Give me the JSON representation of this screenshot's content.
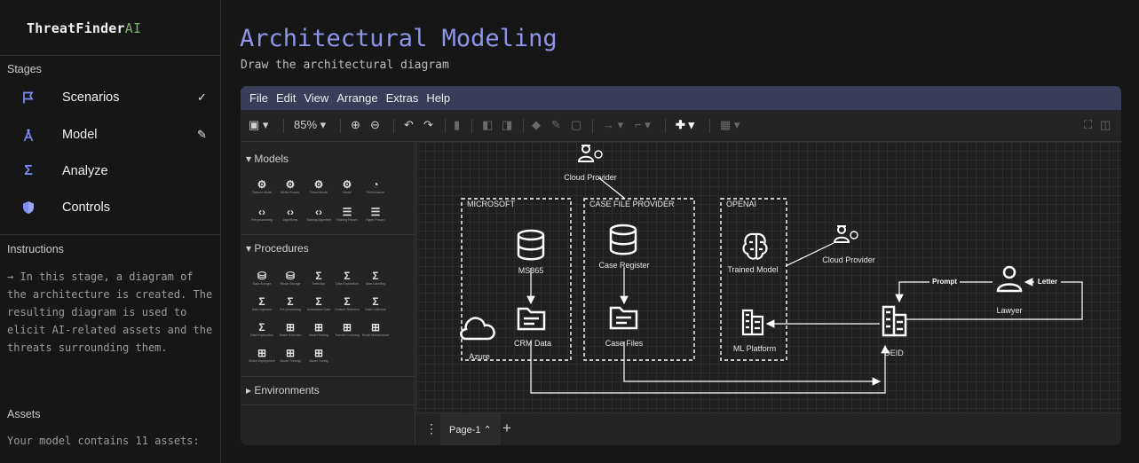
{
  "app": {
    "brand_name": "ThreatFinder",
    "brand_suffix": "AI"
  },
  "sidebar": {
    "stages_label": "Stages",
    "stages": [
      {
        "label": "Scenarios",
        "icon": "flag-icon",
        "status": "✓"
      },
      {
        "label": "Model",
        "icon": "compass-icon",
        "status": "✎"
      },
      {
        "label": "Analyze",
        "icon": "sigma-icon",
        "status": ""
      },
      {
        "label": "Controls",
        "icon": "shield-icon",
        "status": ""
      }
    ],
    "instructions_label": "Instructions",
    "instructions_text": "→ In this stage, a diagram of the architecture is created. The resulting diagram is used to elicit AI-related assets and the threats surrounding them.",
    "assets_label": "Assets",
    "assets_text": "Your model contains 11 assets:"
  },
  "main": {
    "title": "Architectural Modeling",
    "subtitle": "Draw the architectural diagram"
  },
  "editor": {
    "menu": [
      "File",
      "Edit",
      "View",
      "Arrange",
      "Extras",
      "Help"
    ],
    "zoom": "85%",
    "palette": {
      "models_label": "Models",
      "models_items": [
        "Trained Model",
        "Model Param.",
        "Tuned Model",
        "Model",
        "Performance",
        "Pre-processing",
        "Algorithms",
        "Training Algorithm",
        "Training Param.",
        "Hyper Param."
      ],
      "procedures_label": "Procedures",
      "procedures_items": [
        "Data Storage",
        "Model Storage",
        "Detection",
        "Data Exploration",
        "Data Labelling",
        "Data Ingestion",
        "Pre-processing",
        "Understand Data",
        "Feature Selection",
        "Data Collection",
        "Data Exploration",
        "Model Selection",
        "Model Testing",
        "Transfer Learning",
        "Model Maintenance",
        "Model Deployment",
        "Model Training",
        "Model Tuning"
      ],
      "environments_label": "Environments"
    },
    "diagram": {
      "containers": [
        "MICROSOFT",
        "CASE FILE PROVIDER",
        "OPENAI"
      ],
      "nodes": {
        "cloud_provider_top": "Cloud Provider",
        "ms365": "MS365",
        "crm_data": "CRM Data",
        "azure": "Azure",
        "case_register": "Case Register",
        "case_files": "Case Files",
        "trained_model": "Trained Model",
        "ml_platform": "ML Platform",
        "cloud_provider_right": "Cloud Provider",
        "lawyer": "Lawyer",
        "deid": "DEID"
      },
      "edge_labels": {
        "prompt": "Prompt",
        "letter": "Letter"
      }
    },
    "page_tab": "Page-1"
  }
}
